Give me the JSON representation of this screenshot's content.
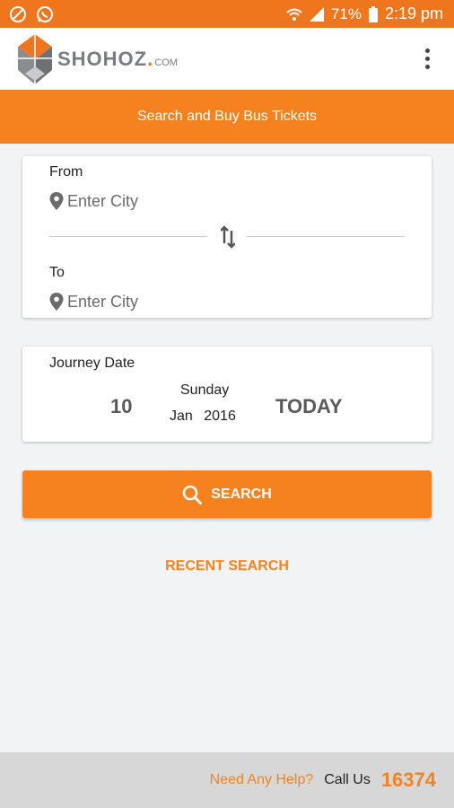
{
  "status_bar": {
    "battery": "71%",
    "time": "2:19 pm",
    "icons": [
      "no-sim-icon",
      "whatsapp-icon",
      "wifi-icon",
      "signal-icon",
      "battery-icon"
    ]
  },
  "app_bar": {
    "logo_name": "SHOHOZ",
    "logo_dot": ".",
    "logo_suffix": "COM",
    "menu_icon": "more-vertical-icon"
  },
  "banner": {
    "title": "Search and Buy Bus Tickets"
  },
  "route": {
    "from_label": "From",
    "from_placeholder": "Enter City",
    "to_label": "To",
    "to_placeholder": "Enter City",
    "swap_icon": "swap-vertical-icon",
    "pin_icon": "map-pin-icon"
  },
  "journey": {
    "label": "Journey Date",
    "day": "10",
    "weekday": "Sunday",
    "month": "Jan",
    "year": "2016",
    "today_label": "TODAY"
  },
  "search": {
    "label": "SEARCH",
    "icon": "search-icon"
  },
  "recent": {
    "label": "RECENT SEARCH"
  },
  "help": {
    "question": "Need Any Help?",
    "call_label": "Call Us",
    "phone": "16374"
  },
  "colors": {
    "brand_orange": "#f5821f",
    "status_orange": "#f0761e",
    "logo_gray": "#7a7c80"
  }
}
